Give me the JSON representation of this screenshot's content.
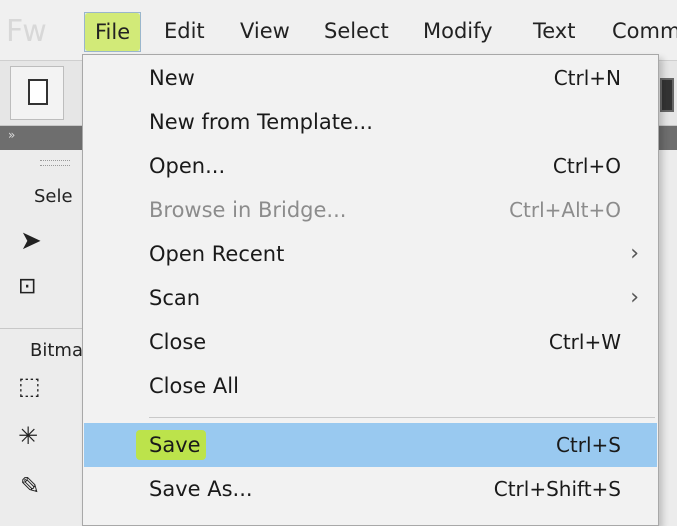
{
  "app": {
    "logo": "Fw"
  },
  "menubar": {
    "items": [
      {
        "label": "File"
      },
      {
        "label": "Edit"
      },
      {
        "label": "View"
      },
      {
        "label": "Select"
      },
      {
        "label": "Modify"
      },
      {
        "label": "Text"
      },
      {
        "label": "Comm"
      }
    ]
  },
  "tools_panel": {
    "select_section": "Sele",
    "bitmap_section": "Bitma"
  },
  "file_menu": {
    "items": [
      {
        "label": "New",
        "shortcut": "Ctrl+N"
      },
      {
        "label": "New from Template...",
        "shortcut": ""
      },
      {
        "label": "Open...",
        "shortcut": "Ctrl+O"
      },
      {
        "label": "Browse in Bridge...",
        "shortcut": "Ctrl+Alt+O"
      },
      {
        "label": "Open Recent",
        "shortcut": "",
        "submenu_arrow": "›"
      },
      {
        "label": "Scan",
        "shortcut": "",
        "submenu_arrow": "›"
      },
      {
        "label": "Close",
        "shortcut": "Ctrl+W"
      },
      {
        "label": "Close All",
        "shortcut": ""
      },
      {
        "label": "Save",
        "shortcut": "Ctrl+S"
      },
      {
        "label": "Save As...",
        "shortcut": "Ctrl+Shift+S"
      }
    ]
  },
  "colors": {
    "selection": "#99c9f0",
    "highlighter": "#c8eb14"
  }
}
